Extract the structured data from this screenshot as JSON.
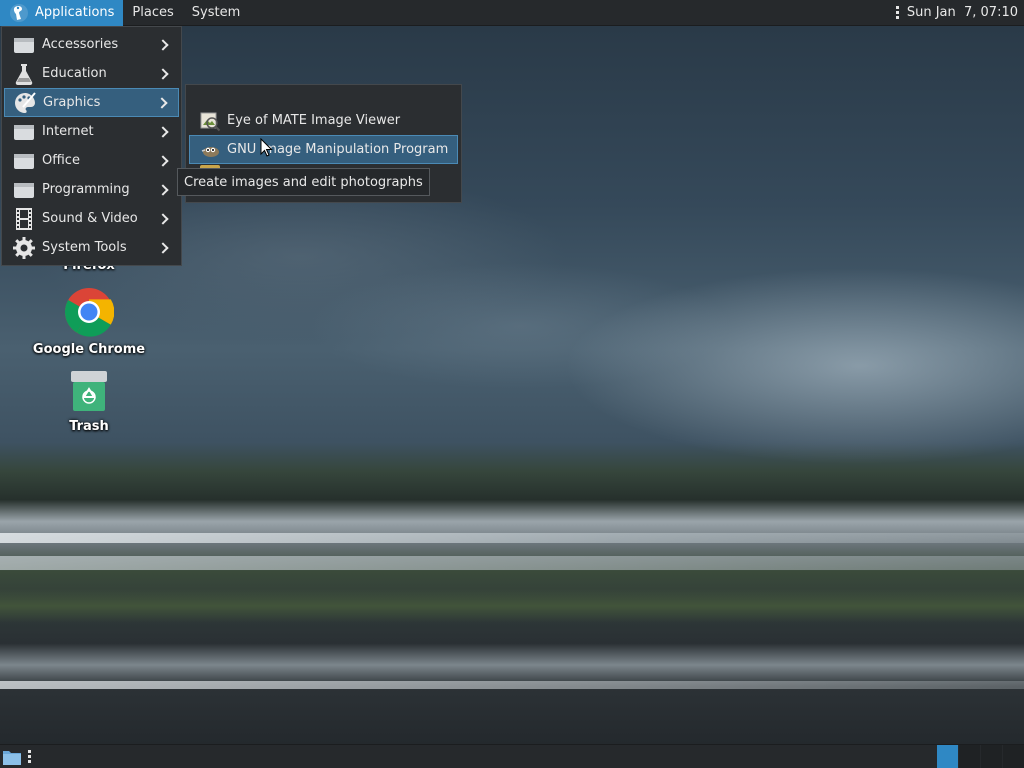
{
  "panel": {
    "applications_label": "Applications",
    "places_label": "Places",
    "system_label": "System",
    "clock": "Sun Jan  7, 07:10"
  },
  "app_menu": {
    "items": [
      {
        "label": "Accessories",
        "icon": "accessories-icon"
      },
      {
        "label": "Education",
        "icon": "flask-icon"
      },
      {
        "label": "Graphics",
        "icon": "graphics-icon"
      },
      {
        "label": "Internet",
        "icon": "internet-icon"
      },
      {
        "label": "Office",
        "icon": "office-icon"
      },
      {
        "label": "Programming",
        "icon": "programming-icon"
      },
      {
        "label": "Sound & Video",
        "icon": "film-icon"
      },
      {
        "label": "System Tools",
        "icon": "gear-icon"
      }
    ],
    "highlighted": "Graphics"
  },
  "graphics_submenu": {
    "items": [
      {
        "label": "Eye of MATE Image Viewer",
        "icon": "image-viewer-icon"
      },
      {
        "label": "GNU Image Manipulation Program",
        "icon": "gimp-icon"
      }
    ],
    "highlighted": "GNU Image Manipulation Program"
  },
  "tooltip": "Create images and edit photographs",
  "desktop": {
    "icons": [
      {
        "label": "Firefox",
        "icon": "firefox-icon"
      },
      {
        "label": "Google Chrome",
        "icon": "chrome-icon"
      },
      {
        "label": "Trash",
        "icon": "trash-icon"
      }
    ]
  },
  "colors": {
    "accent": "#2f88c4",
    "panel_bg": "#26292c",
    "menu_bg": "#2b2e31",
    "highlight_bg": "#355f7e",
    "highlight_border": "#4b8ab5"
  }
}
